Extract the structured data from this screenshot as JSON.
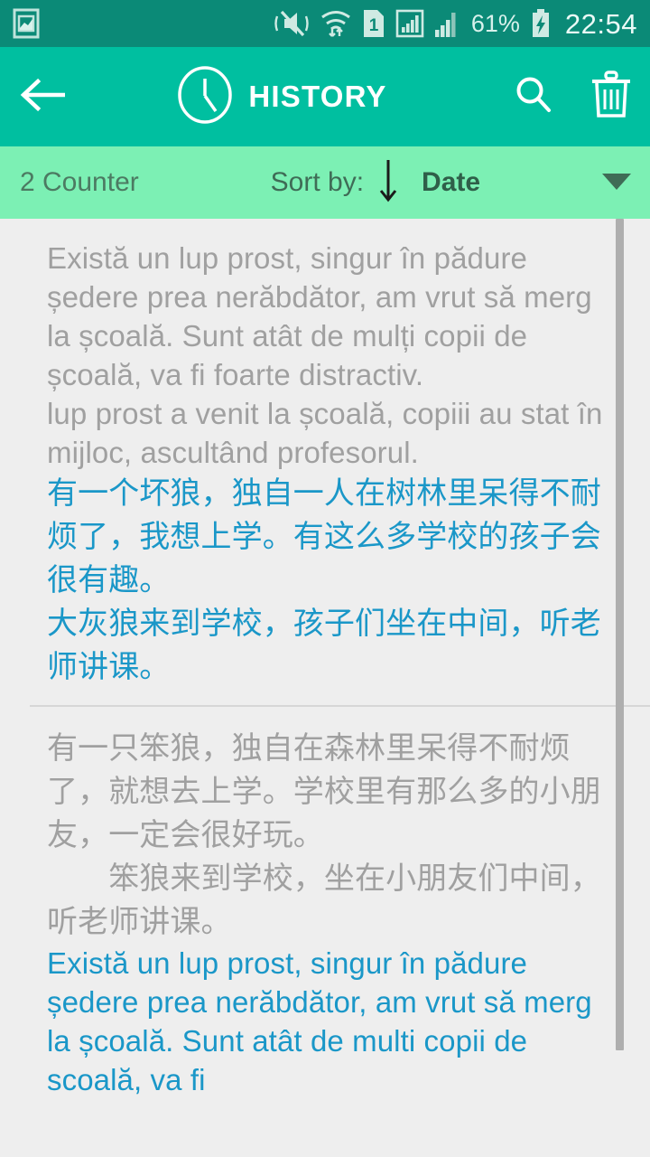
{
  "status_bar": {
    "left_icons": [
      {
        "name": "screenshot-icon",
        "label": "screenshot"
      }
    ],
    "right_icons": [
      {
        "name": "mute-vibrate-icon",
        "label": "sound off / vibrate"
      },
      {
        "name": "wifi-transfer-icon",
        "label": "wifi with data transfer"
      },
      {
        "name": "sim-card-1-icon",
        "label": "SIM 1"
      },
      {
        "name": "signal-boxed-icon",
        "label": "mobile signal boxed"
      },
      {
        "name": "signal-bars-icon",
        "label": "mobile signal bars"
      }
    ],
    "battery_percent": "61%",
    "battery_charging": true,
    "clock": "22:54"
  },
  "app_bar": {
    "back_icon": "back-arrow-icon",
    "clock_icon": "clock-icon",
    "title": "HISTORY",
    "search_icon": "search-icon",
    "delete_icon": "trash-icon"
  },
  "sort_bar": {
    "counter": "2 Counter",
    "sort_label": "Sort by:",
    "sort_direction_icon": "arrow-down-icon",
    "sort_value": "Date",
    "dropdown_icon": "caret-down-icon"
  },
  "history": {
    "items": [
      {
        "source_text": "Există un lup prost, singur în pădure ședere prea nerăbdător, am vrut să merg la școală. Sunt atât de mulți copii de școală, va fi foarte distractiv.\nlup prost a venit la școală, copiii au stat în mijloc, ascultând profesorul.",
        "source_lang": "ro",
        "target_text": "有一个坏狼，独自一人在树林里呆得不耐烦了，我想上学。有这么多学校的孩子会很有趣。\n大灰狼来到学校，孩子们坐在中间，听老师讲课。",
        "target_lang": "zh"
      },
      {
        "source_text": "有一只笨狼，独自在森林里呆得不耐烦了，就想去上学。学校里有那么多的小朋友，一定会很好玩。\n　　笨狼来到学校，坐在小朋友们中间，听老师讲课。",
        "source_lang": "zh",
        "target_text": "Există un lup prost, singur în pădure ședere prea nerăbdător, am vrut să merg la școală. Sunt atât de multi copii de scoală, va fi",
        "target_lang": "ro"
      }
    ]
  },
  "colors": {
    "status_bar_bg": "#0b8a77",
    "app_bar_bg": "#00bfa0",
    "sort_bar_bg": "#7cf0b4",
    "page_bg": "#eeeeee",
    "source_text": "#a0a0a0",
    "target_text": "#1a97c8",
    "scrollbar": "#aeaeae"
  }
}
